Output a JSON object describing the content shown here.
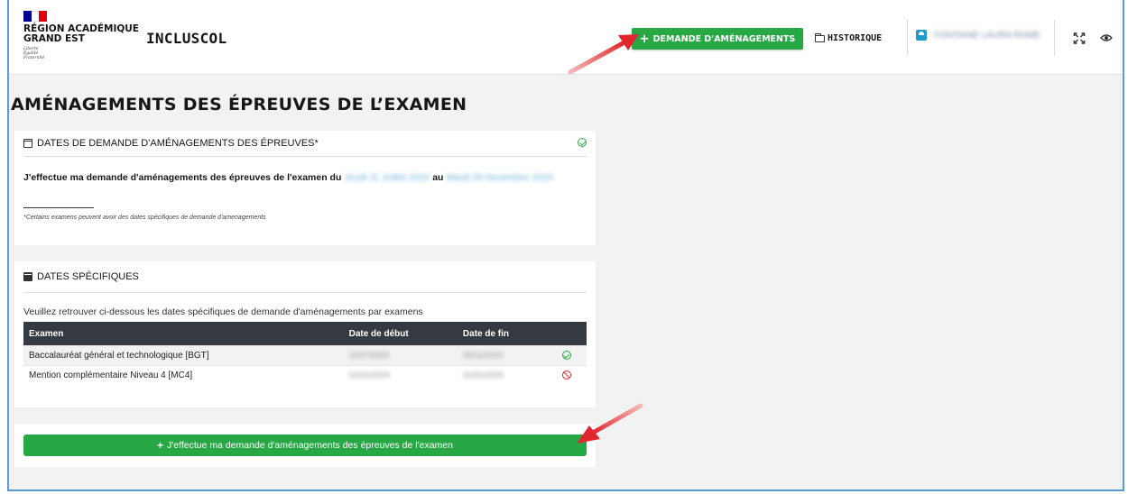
{
  "header": {
    "region_lines": "RÉGION ACADÉMIQUE\nGRAND EST",
    "motto": "Liberté\nÉgalité\nFraternité",
    "app_title": "INCLUSCOL",
    "demande_button": "DEMANDE D'AMÉNAGEMENTS",
    "historique_link": "HISTORIQUE",
    "user_name": "FONTAINE LAURA ROME",
    "icons": [
      "folder-icon",
      "user-icon",
      "fullscreen-icon",
      "eye-icon"
    ]
  },
  "page": {
    "title": "AMÉNAGEMENTS DES ÉPREUVES DE L’EXAMEN"
  },
  "dates_card": {
    "heading": "DATES DE DEMANDE D'AMÉNAGEMENTS DES ÉPREUVES*",
    "sentence_prefix": "J'effectue ma demande d'aménagements des épreuves de l'examen du",
    "date_start": "Jeudi 11 Juillet 2024",
    "connector": "au",
    "date_end": "Mardi 05 Novembre 2024",
    "footnote": "*Certains examens peuvent avoir des dates spécifiques de demande d'amenagements",
    "status": "ok"
  },
  "specific_card": {
    "heading": "DATES SPÉCIFIQUES",
    "intro": "Veuillez retrouver ci-dessous les dates spécifiques de demande d'aménagements par examens",
    "columns": [
      "Examen",
      "Date de début",
      "Date de fin"
    ],
    "rows": [
      {
        "exam": "Baccalauréat général et technologique [BGT]",
        "start": "11/07/2024",
        "end": "05/11/2024",
        "status": "ok"
      },
      {
        "exam": "Mention complémentaire Niveau 4 [MC4]",
        "start": "02/12/2024",
        "end": "31/01/2025",
        "status": "closed"
      }
    ]
  },
  "cta": {
    "label": "J'effectue ma demande d'aménagements des épreuves de l'examen"
  },
  "colors": {
    "accent_green": "#28a745",
    "table_header": "#343a40",
    "arrow_red": "#e0272f",
    "frame_blue": "#5a9bd5"
  }
}
